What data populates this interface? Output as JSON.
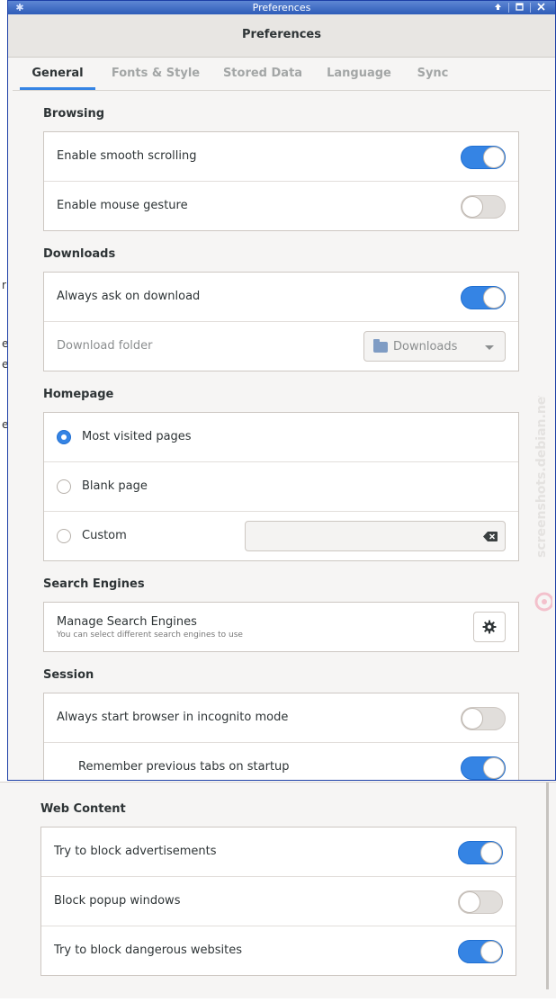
{
  "window": {
    "title": "Preferences",
    "header_title": "Preferences"
  },
  "tabs": [
    {
      "label": "General",
      "active": true
    },
    {
      "label": "Fonts & Style",
      "active": false
    },
    {
      "label": "Stored Data",
      "active": false
    },
    {
      "label": "Language",
      "active": false
    },
    {
      "label": "Sync",
      "active": false
    }
  ],
  "browsing": {
    "heading": "Browsing",
    "smooth_scrolling": {
      "label": "Enable smooth scrolling",
      "on": true
    },
    "mouse_gesture": {
      "label": "Enable mouse gesture",
      "on": false
    }
  },
  "downloads": {
    "heading": "Downloads",
    "always_ask": {
      "label": "Always ask on download",
      "on": true
    },
    "folder_label": "Download folder",
    "folder_value": "Downloads"
  },
  "homepage": {
    "heading": "Homepage",
    "options": [
      {
        "label": "Most visited pages",
        "checked": true
      },
      {
        "label": "Blank page",
        "checked": false
      },
      {
        "label": "Custom",
        "checked": false
      }
    ],
    "custom_value": ""
  },
  "search_engines": {
    "heading": "Search Engines",
    "title": "Manage Search Engines",
    "subtitle": "You can select different search engines to use"
  },
  "session": {
    "heading": "Session",
    "incognito": {
      "label": "Always start browser in incognito mode",
      "on": false
    },
    "remember_tabs": {
      "label": "Remember previous tabs on startup",
      "on": true
    }
  },
  "web_content": {
    "heading": "Web Content",
    "block_ads": {
      "label": "Try to block advertisements",
      "on": true
    },
    "block_popups": {
      "label": "Block popup windows",
      "on": false
    },
    "block_dangerous": {
      "label": "Try to block dangerous websites",
      "on": true
    }
  },
  "watermark": "screenshots.debian.net",
  "colors": {
    "accent": "#3584e4",
    "titlebar": "#2e5cb8"
  }
}
